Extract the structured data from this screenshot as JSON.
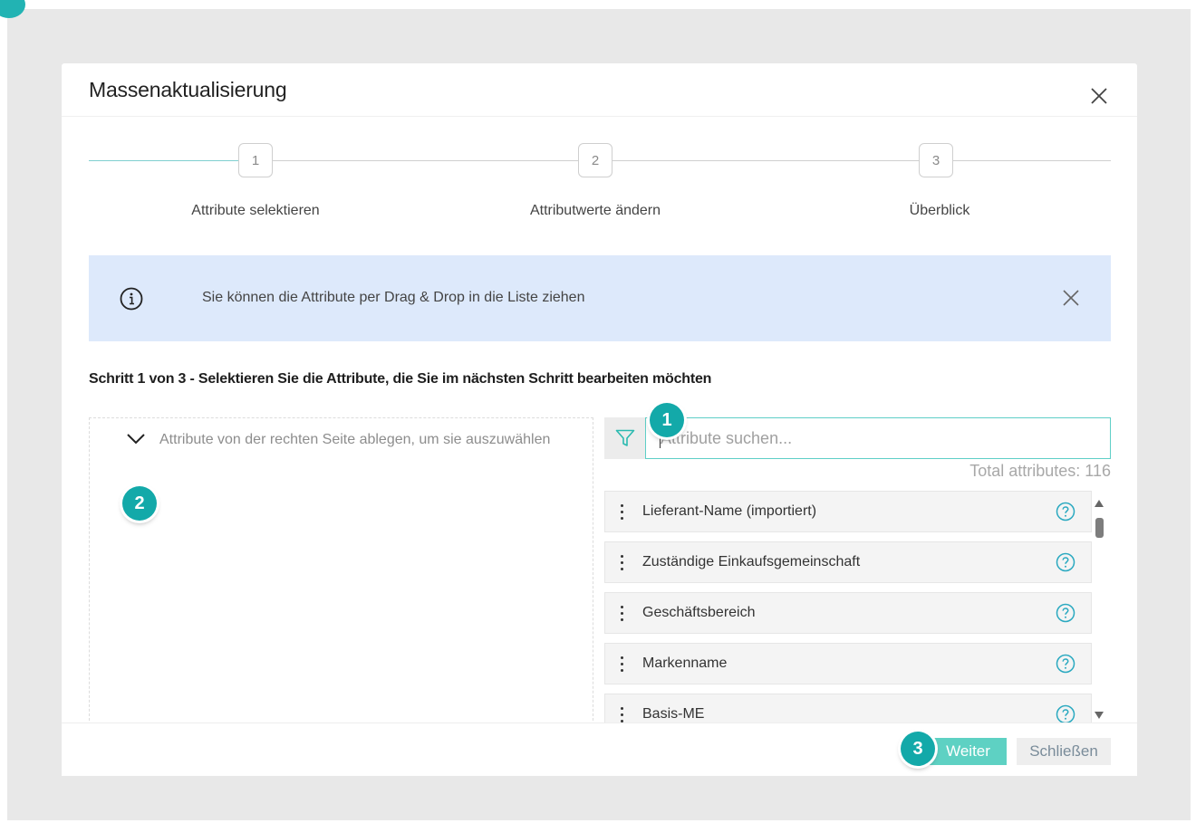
{
  "colors": {
    "accent": "#5ed1c3",
    "badge": "#13a9a9",
    "info_banner": "#dde9fb",
    "backdrop": "#e8e8e8"
  },
  "modal": {
    "title": "Massenaktualisierung",
    "close_icon": "close-icon"
  },
  "stepper": {
    "steps": [
      {
        "number": "1",
        "label": "Attribute selektieren",
        "active": true
      },
      {
        "number": "2",
        "label": "Attributwerte ändern",
        "active": false
      },
      {
        "number": "3",
        "label": "Überblick",
        "active": false
      }
    ]
  },
  "info": {
    "icon": "info-icon",
    "text": "Sie können die Attribute per Drag & Drop in die Liste ziehen"
  },
  "instruction": "Schritt 1 von 3 - Selektieren Sie die Attribute, die Sie im nächsten Schritt bearbeiten möchten",
  "selection": {
    "drop_hint": "Attribute von der rechten Seite ablegen, um sie auszuwählen"
  },
  "attributes": {
    "search_placeholder": "Attribute suchen...",
    "search_value": "",
    "total": "Total attributes: 116",
    "items": [
      {
        "label": "Lieferant-Name (importiert)"
      },
      {
        "label": "Zuständige Einkaufsgemeinschaft"
      },
      {
        "label": "Geschäftsbereich"
      },
      {
        "label": "Markenname"
      },
      {
        "label": "Basis-ME"
      }
    ]
  },
  "footer": {
    "next_label": "Weiter",
    "close_label": "Schließen"
  },
  "badges": [
    "1",
    "2",
    "3"
  ]
}
